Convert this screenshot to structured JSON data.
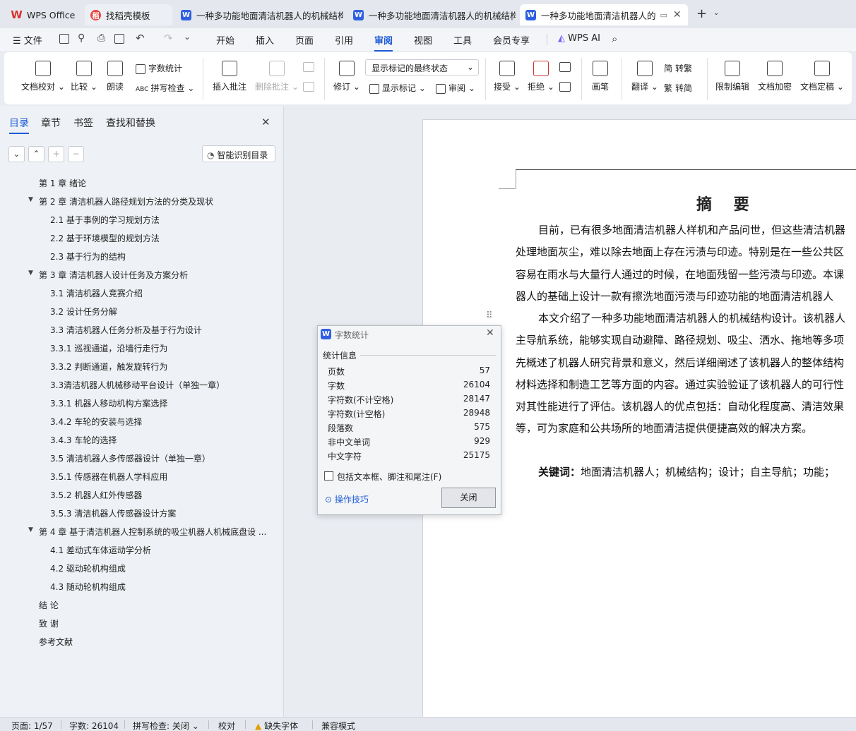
{
  "tabs": [
    {
      "label": "WPS Office",
      "icon": "wps-logo-icon"
    },
    {
      "label": "找稻壳模板",
      "icon": "docer-icon"
    },
    {
      "label": "一种多功能地面清洁机器人的机械结构",
      "icon": "word-doc-icon"
    },
    {
      "label": "一种多功能地面清洁机器人的机械结构",
      "icon": "word-doc-icon"
    },
    {
      "label": "一种多功能地面清洁机器人的",
      "icon": "word-doc-icon",
      "active": true
    }
  ],
  "menu": {
    "file": "文件",
    "items": [
      "开始",
      "插入",
      "页面",
      "引用",
      "审阅",
      "视图",
      "工具",
      "会员专享"
    ],
    "active": "审阅",
    "wps_ai": "WPS AI"
  },
  "ribbon": {
    "doc_proof": "文档校对",
    "compare": "比较",
    "read_aloud": "朗读",
    "word_count": "字数统计",
    "spell_check": "拼写检查",
    "insert_comment": "插入批注",
    "delete_comment": "删除批注",
    "track": "修订",
    "markup_state": "显示标记的最终状态",
    "show_markup": "显示标记",
    "review": "审阅",
    "accept": "接受",
    "reject": "拒绝",
    "pen": "画笔",
    "translate": "翻译",
    "to_traditional": "转繁",
    "to_simplified": "转简",
    "restrict_edit": "限制编辑",
    "encrypt": "文档加密",
    "finalize": "文档定稿"
  },
  "nav": {
    "tabs": [
      "目录",
      "章节",
      "书签",
      "查找和替换"
    ],
    "smart_toc": "智能识别目录",
    "toc": [
      {
        "text": "第 1 章   绪论",
        "level": 1
      },
      {
        "text": "第 2 章   清洁机器人路径规划方法的分类及现状",
        "level": 1,
        "expand": true
      },
      {
        "text": "2.1  基于事例的学习规划方法",
        "level": 2
      },
      {
        "text": "2.2  基于环境模型的规划方法",
        "level": 2
      },
      {
        "text": "2.3  基于行为的结构",
        "level": 2
      },
      {
        "text": "第 3 章  清洁机器人设计任务及方案分析",
        "level": 1,
        "expand": true
      },
      {
        "text": "3.1  清洁机器人竞赛介绍",
        "level": 2
      },
      {
        "text": "3.2  设计任务分解",
        "level": 2
      },
      {
        "text": "3.3  清洁机器人任务分析及基于行为设计",
        "level": 2
      },
      {
        "text": "3.3.1  巡视通道，沿墙行走行为",
        "level": 2
      },
      {
        "text": "3.3.2  判断通道，触发旋转行为",
        "level": 2
      },
      {
        "text": "3.3清洁机器人机械移动平台设计（单独一章）",
        "level": 2
      },
      {
        "text": "3.3.1  机器人移动机构方案选择",
        "level": 2
      },
      {
        "text": "3.4.2  车轮的安装与选择",
        "level": 2
      },
      {
        "text": "3.4.3  车轮的选择",
        "level": 2
      },
      {
        "text": "3.5  清洁机器人多传感器设计（单独一章）",
        "level": 2
      },
      {
        "text": "3.5.1  传感器在机器人学科应用",
        "level": 2
      },
      {
        "text": "3.5.2  机器人红外传感器",
        "level": 2
      },
      {
        "text": "3.5.3 清洁机器人传感器设计方案",
        "level": 2
      },
      {
        "text": "第 4 章  基于清洁机器人控制系统的吸尘机器人机械底盘设 ...",
        "level": 1,
        "expand": true
      },
      {
        "text": "4.1 差动式车体运动学分析",
        "level": 2
      },
      {
        "text": "4.2  驱动轮机构组成",
        "level": 2
      },
      {
        "text": "4.3  随动轮机构组成",
        "level": 2
      },
      {
        "text": "结  论",
        "level": 1
      },
      {
        "text": "致  谢",
        "level": 1
      },
      {
        "text": "参考文献",
        "level": 1
      }
    ]
  },
  "document": {
    "heading": "摘    要",
    "lines": [
      "目前，已有很多地面清洁机器人样机和产品问世，但这些清洁机器",
      "处理地面灰尘，难以除去地面上存在污渍与印迹。特别是在一些公共区",
      "容易在雨水与大量行人通过的时候，在地面残留一些污渍与印迹。本课",
      "器人的基础上设计一款有擦洗地面污渍与印迹功能的地面清洁机器人",
      "本文介绍了一种多功能地面清洁机器人的机械结构设计。该机器人",
      "主导航系统，能够实现自动避障、路径规划、吸尘、洒水、拖地等多项",
      "先概述了机器人研究背景和意义，然后详细阐述了该机器人的整体结构",
      "材料选择和制造工艺等方面的内容。通过实验验证了该机器人的可行性",
      "对其性能进行了评估。该机器人的优点包括：自动化程度高、清洁效果",
      "等，可为家庭和公共场所的地面清洁提供便捷高效的解决方案。"
    ],
    "keywords_label": "关键词：",
    "keywords": "地面清洁机器人；机械结构；设计；自主导航；功能；"
  },
  "dialog": {
    "title": "字数统计",
    "section": "统计信息",
    "stats": [
      {
        "label": "页数",
        "value": "57"
      },
      {
        "label": "字数",
        "value": "26104"
      },
      {
        "label": "字符数(不计空格)",
        "value": "28147"
      },
      {
        "label": "字符数(计空格)",
        "value": "28948"
      },
      {
        "label": "段落数",
        "value": "575"
      },
      {
        "label": "非中文单词",
        "value": "929"
      },
      {
        "label": "中文字符",
        "value": "25175"
      }
    ],
    "checkbox_label": "包括文本框、脚注和尾注(F)",
    "tips": "操作技巧",
    "close": "关闭"
  },
  "status": {
    "page": "页面: 1/57",
    "words": "字数: 26104",
    "spell": "拼写检查: 关闭",
    "proof": "校对",
    "missing_font": "缺失字体",
    "compat": "兼容模式"
  },
  "colors": {
    "accent": "#1e5bd6",
    "wps_red": "#d9302c",
    "word_blue": "#2f5fe0"
  }
}
